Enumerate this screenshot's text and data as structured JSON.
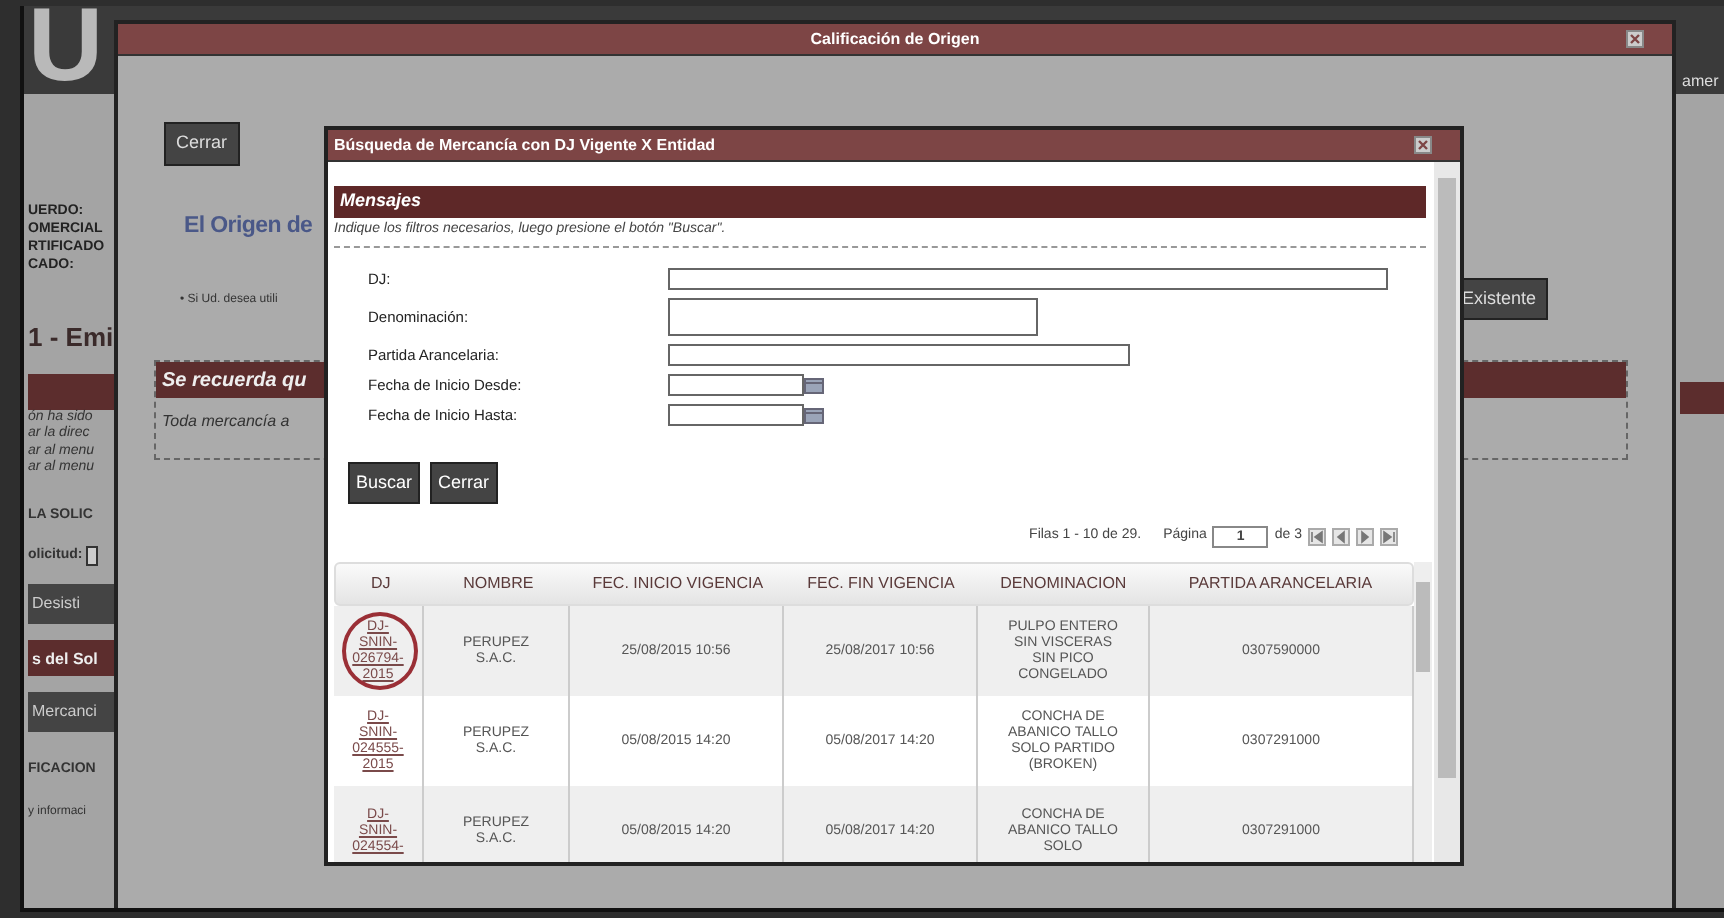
{
  "background_page": {
    "logo_text": "U",
    "header_text": "amer",
    "left_items": [
      {
        "kind": "label",
        "text": "UERDO:"
      },
      {
        "kind": "label",
        "text": "OMERCIAL"
      },
      {
        "kind": "label",
        "text": "RTIFICADO"
      },
      {
        "kind": "label",
        "text": "CADO:"
      },
      {
        "kind": "title",
        "text": "1 - Emi"
      },
      {
        "kind": "bar"
      },
      {
        "kind": "italic",
        "text": "ón ha sido"
      },
      {
        "kind": "italic",
        "text": "ar la direc"
      },
      {
        "kind": "italic",
        "text": "ar al menu"
      },
      {
        "kind": "italic",
        "text": "ar al menu"
      },
      {
        "kind": "section",
        "text": "LA SOLIC"
      },
      {
        "kind": "field",
        "text": "olicitud:"
      },
      {
        "kind": "button",
        "text": "Desisti"
      },
      {
        "kind": "bar",
        "text": "s del Sol"
      },
      {
        "kind": "button",
        "text": "Mercanci"
      },
      {
        "kind": "section",
        "text": "FICACION"
      },
      {
        "kind": "small",
        "text": "y informaci"
      }
    ]
  },
  "outer_dialog": {
    "title": "Calificación de Origen",
    "close_button": "Cerrar",
    "heading": "El Origen de",
    "note": "• Si Ud. desea utili",
    "existing_button": "Existente",
    "notice": {
      "title": "Se recuerda qu",
      "text": "Toda mercancía a"
    }
  },
  "search_dialog": {
    "title": "Búsqueda de Mercancía con DJ Vigente X Entidad",
    "messages": {
      "title": "Mensajes",
      "text": "Indique los filtros necesarios, luego presione el botón \"Buscar\"."
    },
    "fields": [
      {
        "label": "DJ:",
        "kind": "text"
      },
      {
        "label": "Denominación:",
        "kind": "textarea"
      },
      {
        "label": "Partida Arancelaria:",
        "kind": "text"
      },
      {
        "label": "Fecha de Inicio Desde:",
        "kind": "date"
      },
      {
        "label": "Fecha de Inicio Hasta:",
        "kind": "date"
      }
    ],
    "buttons": [
      "Buscar",
      "Cerrar"
    ],
    "pager": {
      "rows_text": "Filas 1 - 10 de 29.",
      "page_label": "Página",
      "page": "1",
      "of_text": "de 3"
    },
    "table": {
      "columns": [
        "DJ",
        "NOMBRE",
        "FEC. INICIO VIGENCIA",
        "FEC. FIN VIGENCIA",
        "DENOMINACION",
        "PARTIDA ARANCELARIA"
      ],
      "rows": [
        {
          "dj": "DJ-SNIN-026794-2015",
          "nombre": "PERUPEZ S.A.C.",
          "inicio": "25/08/2015 10:56",
          "fin": "25/08/2017 10:56",
          "denominacion": "PULPO ENTERO SIN VISCERAS SIN PICO CONGELADO",
          "partida": "0307590000",
          "circled": true
        },
        {
          "dj": "DJ-SNIN-024555-2015",
          "nombre": "PERUPEZ S.A.C.",
          "inicio": "05/08/2015 14:20",
          "fin": "05/08/2017 14:20",
          "denominacion": "CONCHA DE ABANICO TALLO SOLO PARTIDO (BROKEN)",
          "partida": "0307291000",
          "circled": false
        },
        {
          "dj": "DJ-SNIN-024554-",
          "nombre": "PERUPEZ S.A.C.",
          "inicio": "05/08/2015 14:20",
          "fin": "05/08/2017 14:20",
          "denominacion": "CONCHA DE ABANICO TALLO SOLO",
          "partida": "0307291000",
          "circled": false
        }
      ]
    }
  }
}
